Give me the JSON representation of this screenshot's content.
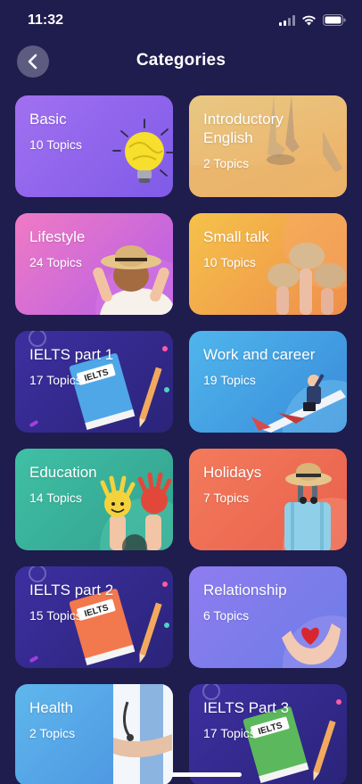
{
  "status_bar": {
    "time": "11:32"
  },
  "header": {
    "title": "Categories",
    "back_icon": "chevron-left-icon"
  },
  "categories": [
    {
      "id": "basic",
      "title": "Basic",
      "topics": "10 Topics",
      "art": "lightbulb"
    },
    {
      "id": "introductory-english",
      "title": "Introductory English",
      "topics": "2 Topics",
      "art": "running-start"
    },
    {
      "id": "lifestyle",
      "title": "Lifestyle",
      "topics": "24 Topics",
      "art": "woman-hat"
    },
    {
      "id": "small-talk",
      "title": "Small talk",
      "topics": "10 Topics",
      "art": "speech-bubbles"
    },
    {
      "id": "ielts-part-1",
      "title": "IELTS part 1",
      "topics": "17 Topics",
      "art": "ielts-book-blue",
      "book_label": "IELTS"
    },
    {
      "id": "work-and-career",
      "title": "Work and career",
      "topics": "19 Topics",
      "art": "businessman-plane"
    },
    {
      "id": "education",
      "title": "Education",
      "topics": "14 Topics",
      "art": "painted-hands"
    },
    {
      "id": "holidays",
      "title": "Holidays",
      "topics": "7 Topics",
      "art": "suitcase"
    },
    {
      "id": "ielts-part-2",
      "title": "IELTS part 2",
      "topics": "15 Topics",
      "art": "ielts-book-orange",
      "book_label": "IELTS"
    },
    {
      "id": "relationship",
      "title": "Relationship",
      "topics": "6 Topics",
      "art": "heart-hands"
    },
    {
      "id": "health",
      "title": "Health",
      "topics": "2 Topics",
      "art": "doctor"
    },
    {
      "id": "ielts-part-3",
      "title": "IELTS Part 3",
      "topics": "17 Topics",
      "art": "ielts-book-green",
      "book_label": "IELTS"
    }
  ]
}
